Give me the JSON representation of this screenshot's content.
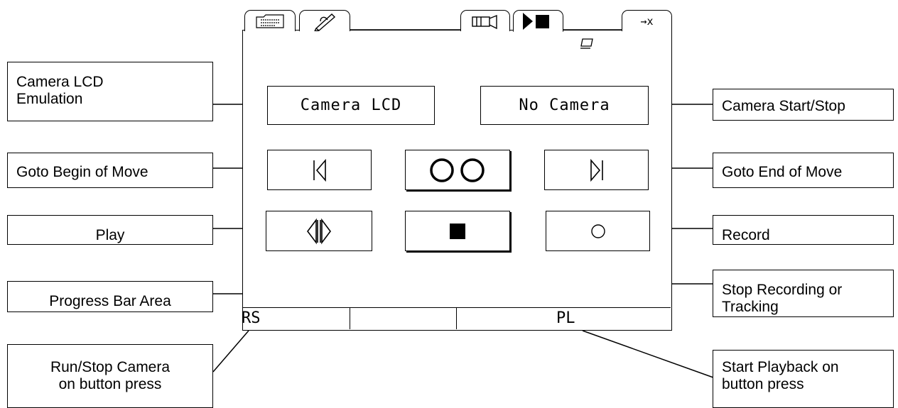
{
  "screen": {
    "tabs": [
      {
        "name": "tab-file",
        "icon": "file-card-icon"
      },
      {
        "name": "tab-edit",
        "icon": "pencil-icon"
      },
      {
        "name": "tab-camera",
        "icon": "camera-icon"
      },
      {
        "name": "tab-playback",
        "icon": "play-stop-icon"
      },
      {
        "name": "tab-exit",
        "icon": "arrow-exit-icon",
        "label": "→x"
      }
    ],
    "buttons": {
      "camera_lcd": "Camera LCD",
      "no_camera": "No Camera"
    },
    "status_bar": {
      "left": "RS",
      "right": "PL"
    }
  },
  "callouts": {
    "camera_lcd_emulation": [
      "Camera LCD",
      "Emulation"
    ],
    "camera_start_stop": "Camera Start/Stop",
    "goto_begin": "Goto Begin of Move",
    "goto_end": "Goto End of Move",
    "play": "Play",
    "record": "Record",
    "progress_bar_area": "Progress Bar Area",
    "stop_recording": [
      "Stop Recording or",
      "Tracking"
    ],
    "run_stop_camera": [
      "Run/Stop Camera",
      "on button press"
    ],
    "start_playback": [
      "Start Playback on",
      "button press"
    ]
  }
}
